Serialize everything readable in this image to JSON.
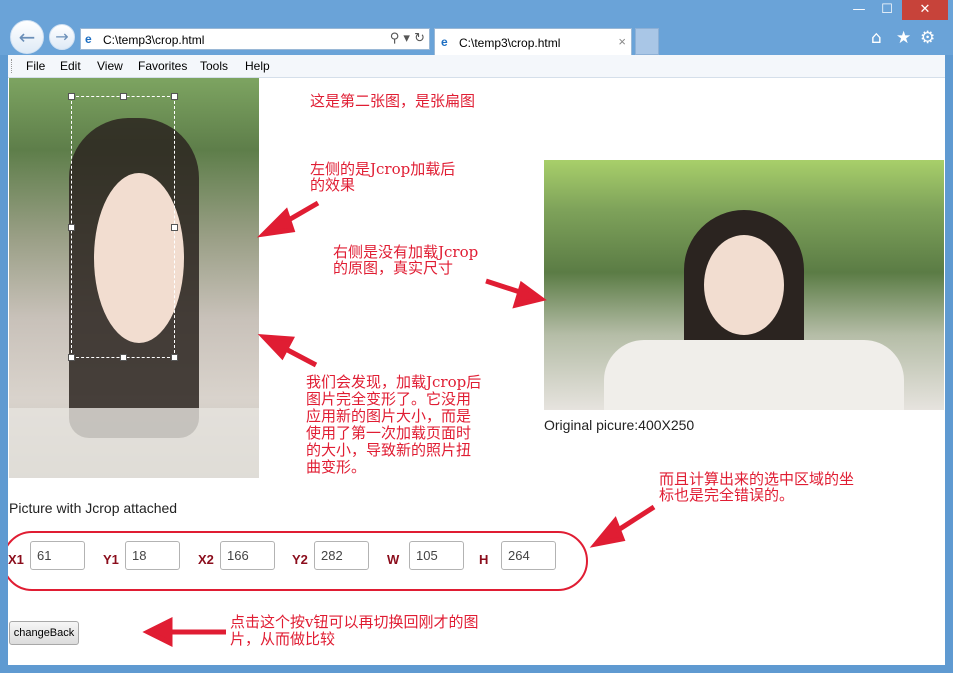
{
  "browser": {
    "address_url": "C:\\temp3\\crop.html",
    "tab_title": "C:\\temp3\\crop.html",
    "tab_close": "×",
    "menu": [
      "File",
      "Edit",
      "View",
      "Favorites",
      "Tools",
      "Help"
    ],
    "window_min": "—",
    "window_max": "☐",
    "window_close": "✕",
    "icons": [
      "back-arrow-icon",
      "forward-arrow-icon",
      "ie-logo-icon",
      "search-icon",
      "refresh-icon",
      "home-icon",
      "favorites-star-icon",
      "settings-gear-icon"
    ]
  },
  "page": {
    "annotation_1": "这是第二张图，是张扁图",
    "annotation_2_line1": "左侧的是Jcrop加载后",
    "annotation_2_line2": "的效果",
    "annotation_3_line1": "右侧是没有加载Jcrop",
    "annotation_3_line2": "的原图，真实尺寸",
    "annotation_4_lines": [
      "我们会发现，加载Jcrop后",
      "图片完全变形了。它没用",
      "应用新的图片大小，而是",
      "使用了第一次加载页面时",
      "的大小，导致新的照片扭",
      "曲变形。"
    ],
    "annotation_5_line1": "而且计算出来的选中区域的坐",
    "annotation_5_line2": "标也是完全错误的。",
    "annotation_6_line1": "点击这个按v钮可以再切换回刚才的图",
    "annotation_6_line2": "片，从而做比较",
    "original_caption": "Original picure:400X250",
    "jcrop_caption": "Picture with Jcrop attached",
    "coords": {
      "x1_label": "X1",
      "x1": "61",
      "y1_label": "Y1",
      "y1": "18",
      "x2_label": "X2",
      "x2": "166",
      "y2_label": "Y2",
      "y2": "282",
      "w_label": "W",
      "w": "105",
      "h_label": "H",
      "h": "264"
    },
    "change_button": "changeBack"
  },
  "colors": {
    "annotation_red": "#e01d33",
    "label_dark_red": "#8b0d1c",
    "window_blue": "#5f9ad1"
  }
}
